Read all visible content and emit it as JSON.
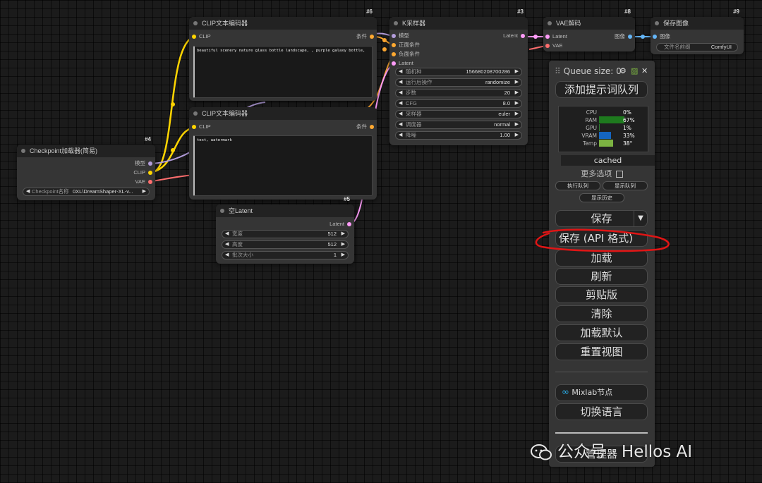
{
  "nodes": {
    "clip_top": {
      "id": "#6",
      "title": "CLIP文本编码器",
      "in_clip": "CLIP",
      "out_cond": "条件",
      "text": "beautiful scenery nature glass bottle landscape, , purple galaxy bottle,"
    },
    "clip_bottom": {
      "id": "",
      "title": "CLIP文本编码器",
      "in_clip": "CLIP",
      "out_cond": "条件",
      "text": "text, watermark"
    },
    "checkpoint": {
      "id": "#4",
      "title": "Checkpoint加载器(简易)",
      "out_model": "模型",
      "out_clip": "CLIP",
      "out_vae": "VAE",
      "widget_label": "Checkpoint名称",
      "widget_value": "0XL\\DreamShaper-XL-v..."
    },
    "latent": {
      "id": "#5",
      "title": "空Latent",
      "out_latent": "Latent",
      "widgets": [
        {
          "label": "宽度",
          "value": "512"
        },
        {
          "label": "高度",
          "value": "512"
        },
        {
          "label": "批次大小",
          "value": "1"
        }
      ]
    },
    "ksampler": {
      "id": "#3",
      "title": "K采样器",
      "out_latent": "Latent",
      "inputs": [
        "模型",
        "正面条件",
        "负面条件",
        "Latent"
      ],
      "widgets": [
        {
          "label": "随机种",
          "value": "156680208700286"
        },
        {
          "label": "运行后操作",
          "value": "randomize"
        },
        {
          "label": "步数",
          "value": "20"
        },
        {
          "label": "CFG",
          "value": "8.0"
        },
        {
          "label": "采样器",
          "value": "euler"
        },
        {
          "label": "调度器",
          "value": "normal"
        },
        {
          "label": "降噪",
          "value": "1.00"
        }
      ]
    },
    "vae": {
      "id": "#8",
      "title": "VAE解码",
      "in_latent": "Latent",
      "in_vae": "VAE",
      "out_image": "图像"
    },
    "save": {
      "id": "#9",
      "title": "保存图像",
      "in_image": "图像",
      "widget_label": "文件名前缀",
      "widget_value": "ComfyUI"
    }
  },
  "menu": {
    "queue_label": "Queue size: 0",
    "queue_prompt": "添加提示词队列",
    "monitor": [
      {
        "label": "CPU",
        "value": "0%",
        "fill": 0.0,
        "color": "#2e7d32"
      },
      {
        "label": "RAM",
        "value": "67%",
        "fill": 0.67,
        "color": "#1e7a1e"
      },
      {
        "label": "GPU",
        "value": "1%",
        "fill": 0.01,
        "color": "#2e7d32"
      },
      {
        "label": "VRAM",
        "value": "33%",
        "fill": 0.33,
        "color": "#1565c0"
      },
      {
        "label": "Temp",
        "value": "38°",
        "fill": 0.38,
        "color": "#7cb342"
      }
    ],
    "cached": "cached",
    "extra_options": "更多选项",
    "view_queue": "执行队列",
    "view_history_queue": "显示队列",
    "view_history": "显示历史",
    "save": "保存",
    "save_api": "保存 (API 格式)",
    "load": "加载",
    "refresh": "刷新",
    "clipspace": "剪贴版",
    "clear": "清除",
    "load_default": "加载默认",
    "reset_view": "重置视图",
    "mixlab": "Mixlab节点",
    "switch_language": "切换语言",
    "manager": "管理器"
  },
  "watermark": "公众号 · Hellos AI",
  "colors": {
    "clip": "#ffd500",
    "model": "#b39ddb",
    "vae": "#ff6e6e",
    "latent": "#ff9cf9",
    "image": "#64b5f6",
    "cond": "#ffa931",
    "annotation": "#e01515"
  }
}
